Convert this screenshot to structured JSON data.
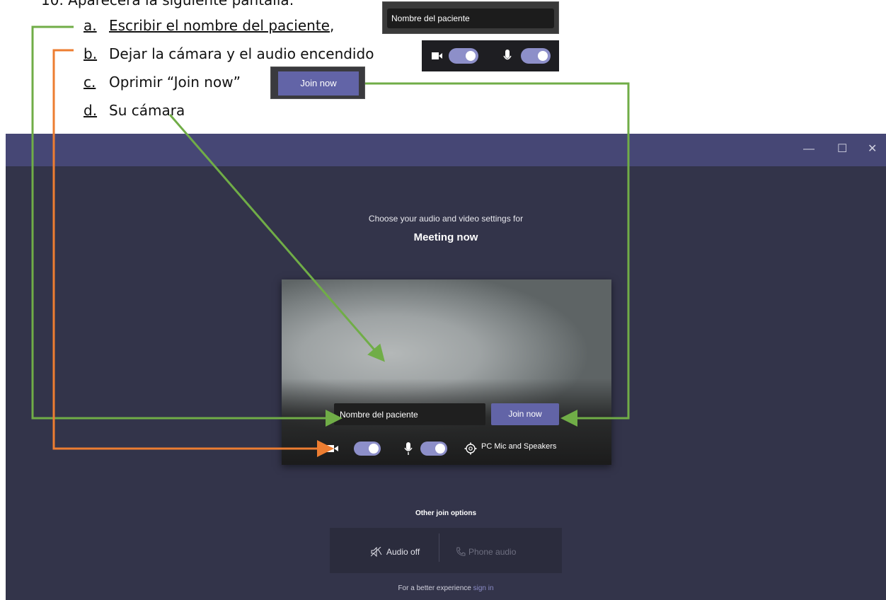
{
  "doc": {
    "heading": "10. Aparecerá la siguiente pantalla:",
    "steps": [
      {
        "letter": "a.",
        "text": "Escribir el nombre del paciente",
        "suffix": ","
      },
      {
        "letter": "b.",
        "text": "Dejar la cámara y el audio encendido"
      },
      {
        "letter": "c.",
        "text": "Oprimir “Join now”"
      },
      {
        "letter": "d.",
        "text": "Su cámara"
      }
    ]
  },
  "snippets": {
    "name_field": "Nombre del paciente",
    "join_button": "Join now"
  },
  "window": {
    "minimize": "—",
    "maximize": "☐",
    "close": "✕"
  },
  "prejoin": {
    "prompt": "Choose your audio and video settings for",
    "meeting_title": "Meeting now",
    "name_value": "Nombre del paciente",
    "join_label": "Join now",
    "camera_on": true,
    "mic_on": true,
    "device_label": "PC Mic and Speakers"
  },
  "other_options": {
    "label": "Other join options",
    "audio_off": "Audio off",
    "phone_audio": "Phone audio"
  },
  "footer": {
    "text": "For a better experience",
    "sign_in": "sign in"
  },
  "colors": {
    "green_arrow": "#70ad47",
    "orange_arrow": "#ed7d31",
    "teams_purple": "#6264a7"
  }
}
